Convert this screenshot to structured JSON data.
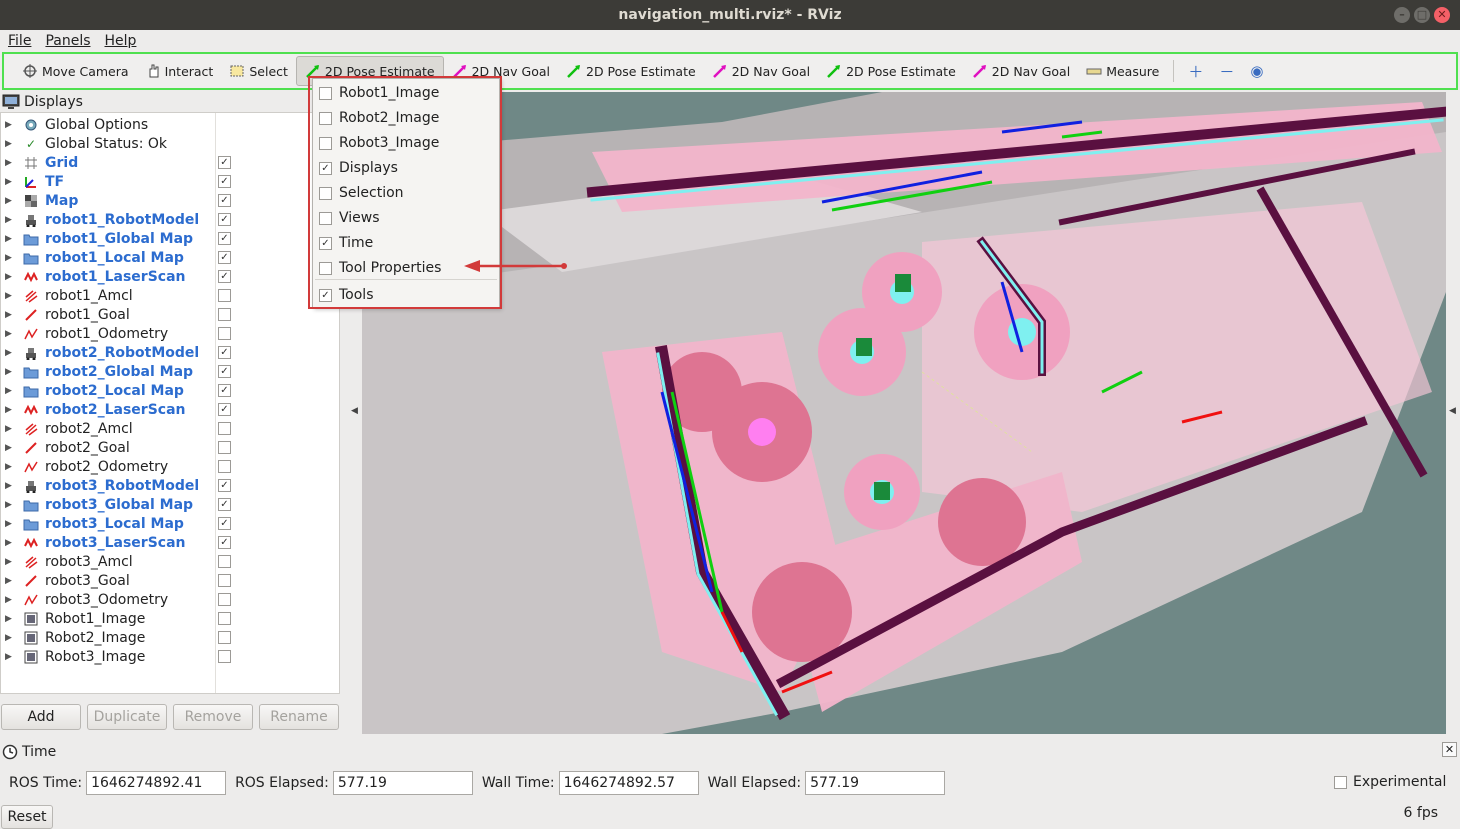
{
  "window": {
    "title": "navigation_multi.rviz* - RViz"
  },
  "menubar": {
    "file": "File",
    "panels": "Panels",
    "help": "Help"
  },
  "toolbar": {
    "tools": [
      {
        "label": "Move Camera",
        "icon": "move-camera-icon"
      },
      {
        "label": "Interact",
        "icon": "hand-icon"
      },
      {
        "label": "Select",
        "icon": "select-icon"
      },
      {
        "label": "2D Pose Estimate",
        "icon": "pose-estimate-icon",
        "active": true
      },
      {
        "label": "2D Nav Goal",
        "icon": "nav-goal-icon"
      },
      {
        "label": "2D Pose Estimate",
        "icon": "pose-estimate-icon"
      },
      {
        "label": "2D Nav Goal",
        "icon": "nav-goal-icon"
      },
      {
        "label": "2D Pose Estimate",
        "icon": "pose-estimate-icon"
      },
      {
        "label": "2D Nav Goal",
        "icon": "nav-goal-icon"
      },
      {
        "label": "Measure",
        "icon": "ruler-icon"
      }
    ]
  },
  "displays": {
    "title": "Displays",
    "items": [
      {
        "label": "Global Options",
        "icon": "gear-icon",
        "checked": null,
        "enabled": false
      },
      {
        "label": "Global Status: Ok",
        "icon": "check-icon",
        "checked": null,
        "enabled": false
      },
      {
        "label": "Grid",
        "icon": "grid-icon",
        "checked": true,
        "enabled": true
      },
      {
        "label": "TF",
        "icon": "tf-icon",
        "checked": true,
        "enabled": true
      },
      {
        "label": "Map",
        "icon": "map-icon",
        "checked": true,
        "enabled": true
      },
      {
        "label": "robot1_RobotModel",
        "icon": "robot-model-icon",
        "checked": true,
        "enabled": true
      },
      {
        "label": "robot1_Global Map",
        "icon": "folder-icon",
        "checked": true,
        "enabled": true
      },
      {
        "label": "robot1_Local Map",
        "icon": "folder-icon",
        "checked": true,
        "enabled": true
      },
      {
        "label": "robot1_LaserScan",
        "icon": "laserscan-icon",
        "checked": true,
        "enabled": true
      },
      {
        "label": "robot1_Amcl",
        "icon": "pose-array-icon",
        "checked": false,
        "enabled": false
      },
      {
        "label": "robot1_Goal",
        "icon": "pose-icon",
        "checked": false,
        "enabled": false
      },
      {
        "label": "robot1_Odometry",
        "icon": "odometry-icon",
        "checked": false,
        "enabled": false
      },
      {
        "label": "robot2_RobotModel",
        "icon": "robot-model-icon",
        "checked": true,
        "enabled": true
      },
      {
        "label": "robot2_Global Map",
        "icon": "folder-icon",
        "checked": true,
        "enabled": true
      },
      {
        "label": "robot2_Local Map",
        "icon": "folder-icon",
        "checked": true,
        "enabled": true
      },
      {
        "label": "robot2_LaserScan",
        "icon": "laserscan-icon",
        "checked": true,
        "enabled": true
      },
      {
        "label": "robot2_Amcl",
        "icon": "pose-array-icon",
        "checked": false,
        "enabled": false
      },
      {
        "label": "robot2_Goal",
        "icon": "pose-icon",
        "checked": false,
        "enabled": false
      },
      {
        "label": "robot2_Odometry",
        "icon": "odometry-icon",
        "checked": false,
        "enabled": false
      },
      {
        "label": "robot3_RobotModel",
        "icon": "robot-model-icon",
        "checked": true,
        "enabled": true
      },
      {
        "label": "robot3_Global Map",
        "icon": "folder-icon",
        "checked": true,
        "enabled": true
      },
      {
        "label": "robot3_Local Map",
        "icon": "folder-icon",
        "checked": true,
        "enabled": true
      },
      {
        "label": "robot3_LaserScan",
        "icon": "laserscan-icon",
        "checked": true,
        "enabled": true
      },
      {
        "label": "robot3_Amcl",
        "icon": "pose-array-icon",
        "checked": false,
        "enabled": false
      },
      {
        "label": "robot3_Goal",
        "icon": "pose-icon",
        "checked": false,
        "enabled": false
      },
      {
        "label": "robot3_Odometry",
        "icon": "odometry-icon",
        "checked": false,
        "enabled": false
      },
      {
        "label": "Robot1_Image",
        "icon": "image-icon",
        "checked": false,
        "enabled": false
      },
      {
        "label": "Robot2_Image",
        "icon": "image-icon",
        "checked": false,
        "enabled": false
      },
      {
        "label": "Robot3_Image",
        "icon": "image-icon",
        "checked": false,
        "enabled": false
      }
    ],
    "buttons": {
      "add": "Add",
      "duplicate": "Duplicate",
      "remove": "Remove",
      "rename": "Rename"
    }
  },
  "panels_menu": {
    "items": [
      {
        "label": "Robot1_Image",
        "checked": false
      },
      {
        "label": "Robot2_Image",
        "checked": false
      },
      {
        "label": "Robot3_Image",
        "checked": false
      },
      {
        "label": "Displays",
        "checked": true
      },
      {
        "label": "Selection",
        "checked": false
      },
      {
        "label": "Views",
        "checked": false
      },
      {
        "label": "Time",
        "checked": true
      },
      {
        "label": "Tool Properties",
        "checked": false
      },
      {
        "label": "Tools",
        "checked": true
      }
    ]
  },
  "time_panel": {
    "title": "Time",
    "ros_time_label": "ROS Time:",
    "ros_time": "1646274892.41",
    "ros_elapsed_label": "ROS Elapsed:",
    "ros_elapsed": "577.19",
    "wall_time_label": "Wall Time:",
    "wall_time": "1646274892.57",
    "wall_elapsed_label": "Wall Elapsed:",
    "wall_elapsed": "577.19",
    "experimental_label": "Experimental",
    "reset_label": "Reset",
    "fps": "6 fps"
  },
  "colors": {
    "toolbar_highlight": "#4fe04f",
    "menu_highlight": "#d23a3a",
    "enabled_display": "#2c6ccf",
    "map_background": "#6f8886",
    "map_free": "#c9c5c6",
    "costmap_inflation": "#d03060",
    "costmap_lethal": "#5a1040",
    "costmap_cyan": "#7ff0f0"
  }
}
